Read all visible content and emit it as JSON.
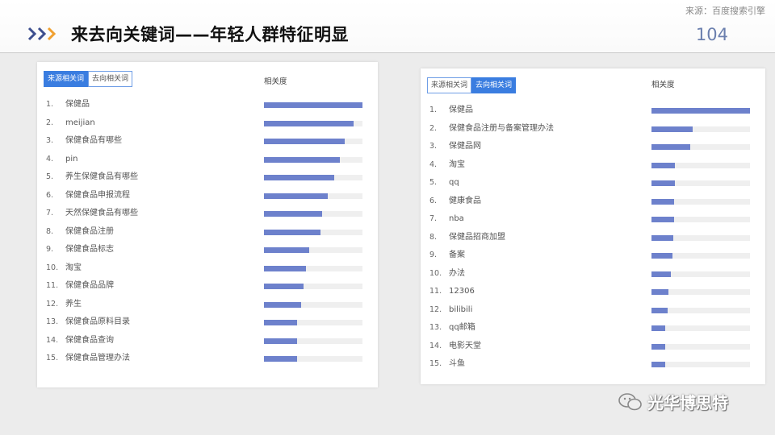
{
  "header": {
    "source": "来源：百度搜索引擎",
    "title": "来去向关键词——年轻人群特征明显",
    "page_number": "104"
  },
  "colors": {
    "accent_blue": "#3a7de0",
    "bar": "#6d81cc",
    "chevron_dark": "#3d4f8f",
    "chevron_orange": "#f0a030"
  },
  "left_panel": {
    "tabs": [
      {
        "label": "来源相关词",
        "active": true
      },
      {
        "label": "去向相关词",
        "active": false
      }
    ],
    "column_header": "相关度",
    "rows": [
      {
        "num": "1.",
        "keyword": "保健品",
        "relevance": 1.0
      },
      {
        "num": "2.",
        "keyword": "meijian",
        "relevance": 0.91
      },
      {
        "num": "3.",
        "keyword": "保健食品有哪些",
        "relevance": 0.82
      },
      {
        "num": "4.",
        "keyword": "pin",
        "relevance": 0.77
      },
      {
        "num": "5.",
        "keyword": "养生保健食品有哪些",
        "relevance": 0.71
      },
      {
        "num": "6.",
        "keyword": "保健食品申报流程",
        "relevance": 0.65
      },
      {
        "num": "7.",
        "keyword": "天然保健食品有哪些",
        "relevance": 0.59
      },
      {
        "num": "8.",
        "keyword": "保健食品注册",
        "relevance": 0.57
      },
      {
        "num": "9.",
        "keyword": "保健食品标志",
        "relevance": 0.46
      },
      {
        "num": "10.",
        "keyword": "淘宝",
        "relevance": 0.43
      },
      {
        "num": "11.",
        "keyword": "保健食品品牌",
        "relevance": 0.4
      },
      {
        "num": "12.",
        "keyword": "养生",
        "relevance": 0.38
      },
      {
        "num": "13.",
        "keyword": "保健食品原料目录",
        "relevance": 0.34
      },
      {
        "num": "14.",
        "keyword": "保健食品查询",
        "relevance": 0.34
      },
      {
        "num": "15.",
        "keyword": "保健食品管理办法",
        "relevance": 0.34
      }
    ]
  },
  "right_panel": {
    "tabs": [
      {
        "label": "来源相关词",
        "active": false
      },
      {
        "label": "去向相关词",
        "active": true
      }
    ],
    "column_header": "相关度",
    "rows": [
      {
        "num": "1.",
        "keyword": "保健品",
        "relevance": 1.0
      },
      {
        "num": "2.",
        "keyword": "保健食品注册与备案管理办法",
        "relevance": 0.42
      },
      {
        "num": "3.",
        "keyword": "保健品网",
        "relevance": 0.39
      },
      {
        "num": "4.",
        "keyword": "淘宝",
        "relevance": 0.24
      },
      {
        "num": "5.",
        "keyword": "qq",
        "relevance": 0.24
      },
      {
        "num": "6.",
        "keyword": "健康食品",
        "relevance": 0.23
      },
      {
        "num": "7.",
        "keyword": "nba",
        "relevance": 0.23
      },
      {
        "num": "8.",
        "keyword": "保健品招商加盟",
        "relevance": 0.22
      },
      {
        "num": "9.",
        "keyword": "备案",
        "relevance": 0.21
      },
      {
        "num": "10.",
        "keyword": "办法",
        "relevance": 0.2
      },
      {
        "num": "11.",
        "keyword": "12306",
        "relevance": 0.17
      },
      {
        "num": "12.",
        "keyword": "bilibili",
        "relevance": 0.16
      },
      {
        "num": "13.",
        "keyword": "qq邮箱",
        "relevance": 0.14
      },
      {
        "num": "14.",
        "keyword": "电影天堂",
        "relevance": 0.14
      },
      {
        "num": "15.",
        "keyword": "斗鱼",
        "relevance": 0.14
      }
    ]
  },
  "watermark": {
    "text": "光华博思特",
    "icon": "wechat-icon"
  }
}
